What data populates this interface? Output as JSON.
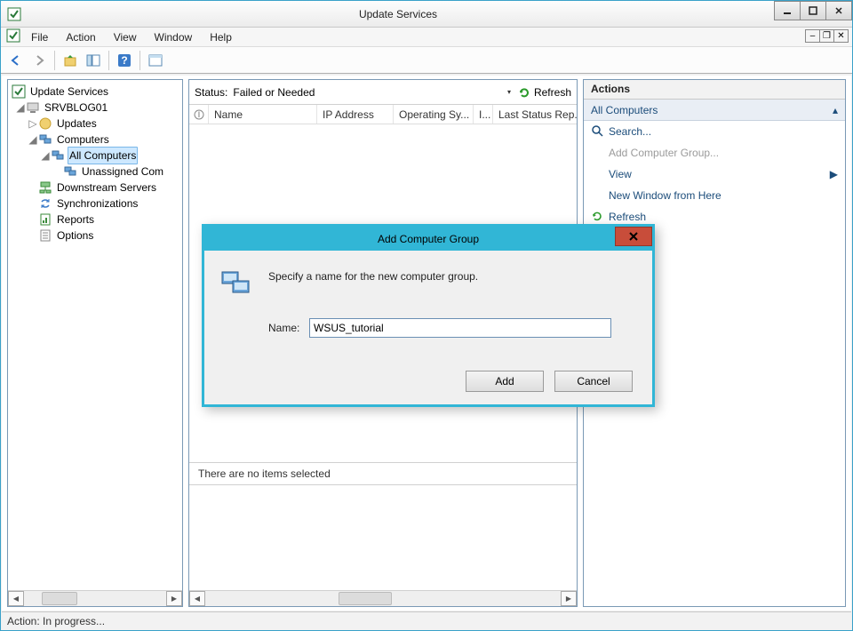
{
  "window": {
    "title": "Update Services"
  },
  "menus": {
    "file": "File",
    "action": "Action",
    "view": "View",
    "window": "Window",
    "help": "Help"
  },
  "tree": {
    "root": "Update Services",
    "server": "SRVBLOG01",
    "updates": "Updates",
    "computers": "Computers",
    "allComputers": "All Computers",
    "unassigned": "Unassigned Com",
    "downstream": "Downstream Servers",
    "sync": "Synchronizations",
    "reports": "Reports",
    "options": "Options"
  },
  "status": {
    "label": "Status:",
    "value": "Failed or Needed",
    "refresh": "Refresh"
  },
  "columns": {
    "name": "Name",
    "ip": "IP Address",
    "os": "Operating Sy...",
    "inst": "I...",
    "last": "Last Status Rep..."
  },
  "selectionText": "There are no items selected",
  "actions": {
    "header": "Actions",
    "context": "All Computers",
    "search": "Search...",
    "addGroup": "Add Computer Group...",
    "view": "View",
    "newWindow": "New Window from Here",
    "refresh": "Refresh"
  },
  "dialog": {
    "title": "Add Computer Group",
    "instruction": "Specify a name for the new computer group.",
    "nameLabel": "Name:",
    "nameValue": "WSUS_tutorial",
    "add": "Add",
    "cancel": "Cancel"
  },
  "statusbar": "Action:  In progress..."
}
